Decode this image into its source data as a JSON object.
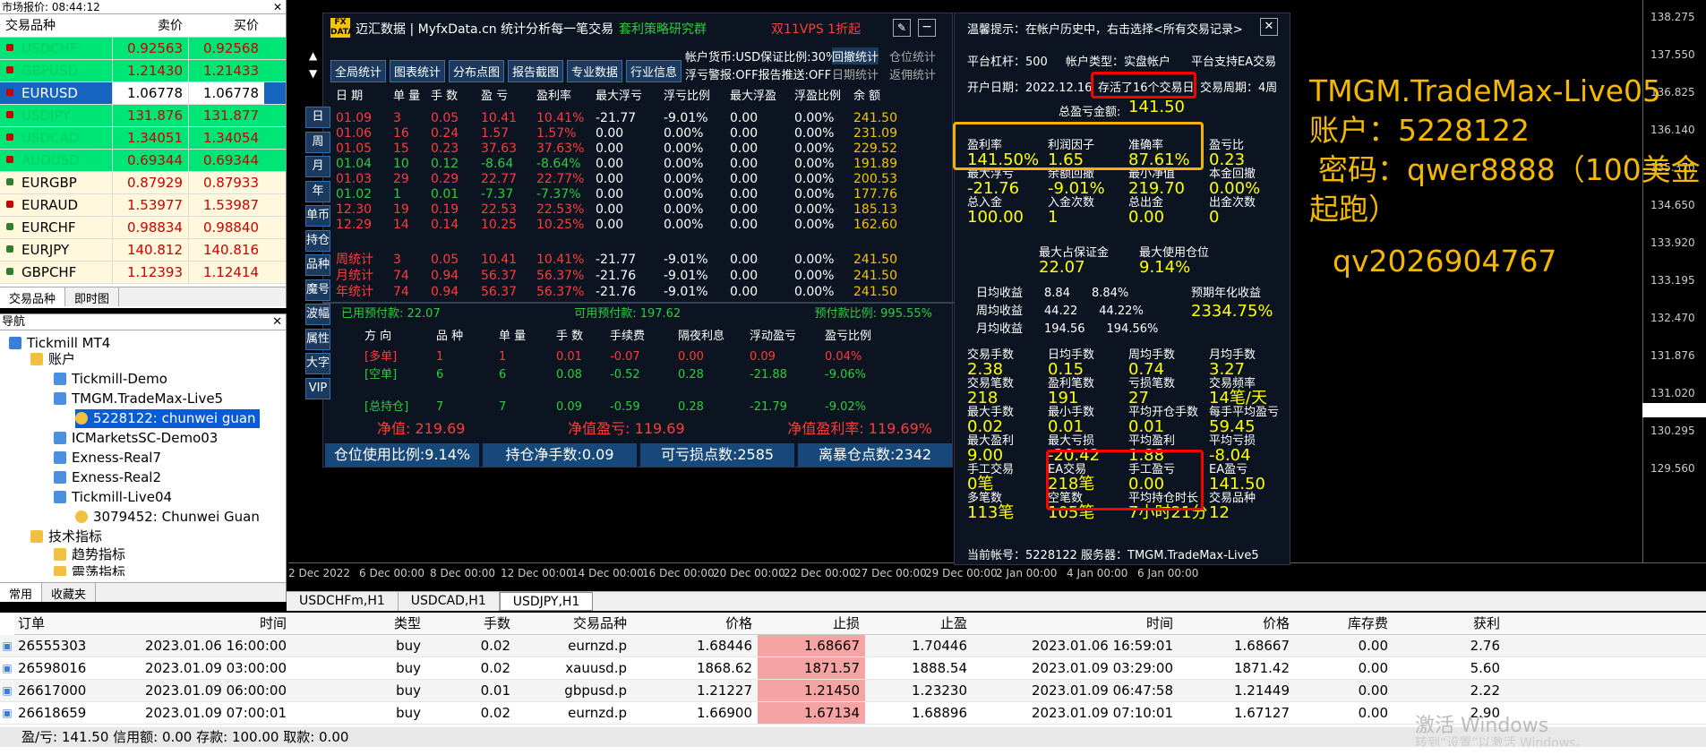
{
  "market_watch": {
    "title": "市场报价: 08:44:12",
    "headers": [
      "交易品种",
      "卖价",
      "买价"
    ],
    "rows": [
      {
        "sym": "USDCHF",
        "bid": "0.92563",
        "ask": "0.92568",
        "bg": "#00e676",
        "ic": "#c00"
      },
      {
        "sym": "GBPUSD",
        "bid": "1.21430",
        "ask": "1.21433",
        "bg": "#00e676",
        "ic": "#c00"
      },
      {
        "sym": "EURUSD",
        "bid": "1.06778",
        "ask": "1.06778",
        "bg": "#1565c0",
        "ic": "#c00"
      },
      {
        "sym": "USDJPY",
        "bid": "131.876",
        "ask": "131.877",
        "bg": "#00e676",
        "ic": "#c00"
      },
      {
        "sym": "USDCAD",
        "bid": "1.34051",
        "ask": "1.34054",
        "bg": "#00e676",
        "ic": "#c00"
      },
      {
        "sym": "AUDUSD",
        "bid": "0.69344",
        "ask": "0.69344",
        "bg": "#00e676",
        "ic": "#c00"
      },
      {
        "sym": "EURGBP",
        "bid": "0.87929",
        "ask": "0.87933",
        "bg": "#fff8dc",
        "ic": "#2e7d32"
      },
      {
        "sym": "EURAUD",
        "bid": "1.53977",
        "ask": "1.53987",
        "bg": "#fff8dc",
        "ic": "#c00"
      },
      {
        "sym": "EURCHF",
        "bid": "0.98834",
        "ask": "0.98840",
        "bg": "#fff8dc",
        "ic": "#2e7d32"
      },
      {
        "sym": "EURJPY",
        "bid": "140.812",
        "ask": "140.816",
        "bg": "#fff8dc",
        "ic": "#2e7d32"
      },
      {
        "sym": "GBPCHF",
        "bid": "1.12393",
        "ask": "1.12414",
        "bg": "#fff8dc",
        "ic": "#2e7d32"
      }
    ],
    "tabs": [
      "交易品种",
      "即时图"
    ]
  },
  "navigator": {
    "title": "导航",
    "items": [
      "Tickmill MT4",
      "账户",
      "Tickmill-Demo",
      "TMGM.TradeMax-Live5",
      "5228122: chunwei guan",
      "ICMarketsSC-Demo03",
      "Exness-Real7",
      "Exness-Real2",
      "Tickmill-Live04",
      "3079452: Chunwei Guan",
      "技术指标",
      "趋势指标",
      "震荡指标"
    ],
    "tabs": [
      "常用",
      "收藏夹"
    ]
  },
  "chart": {
    "yticks": [
      "138.275",
      "137.550",
      "136.825",
      "136.140",
      "135.370",
      "134.650",
      "133.920",
      "133.195",
      "132.470",
      "131.876",
      "131.020",
      "130.295",
      "129.560"
    ],
    "xticks": [
      "2 Dec 2022",
      "6 Dec 00:00",
      "8 Dec 00:00",
      "12 Dec 00:00",
      "14 Dec 00:00",
      "16 Dec 00:00",
      "20 Dec 00:00",
      "22 Dec 00:00",
      "27 Dec 00:00",
      "29 Dec 00:00",
      "2 Jan 00:00",
      "4 Jan 00:00",
      "6 Jan 00:00"
    ],
    "overlay": [
      "TMGM.TradeMax-Live05",
      "账户：5228122",
      "密码：qwer8888（100美金",
      "起跑）",
      "qv2026904767"
    ]
  },
  "stats": {
    "logo": "FX DATA",
    "title": "迈汇数据 | MyfxData.cn  统计分析每一笔交易",
    "promo1": "套利策略研究群",
    "promo2": "双11VPS 1折起",
    "buttons": [
      "全局统计",
      "图表统计",
      "分布点图",
      "报告截图",
      "专业数据",
      "行业信息"
    ],
    "info1": "帐户货币:USD保证比例:30%",
    "info2": "浮亏警报:OFF报告推送:OFF",
    "btn_r": [
      "回撤统计",
      "仓位统计",
      "日期统计",
      "返佣统计"
    ],
    "side_tabs": [
      "日",
      "周",
      "月",
      "年",
      "单币",
      "持仓",
      "品种",
      "魔号",
      "波幅",
      "属性",
      "大字",
      "VIP"
    ],
    "cols": [
      "日 期",
      "单 量",
      "手 数",
      "盈 亏",
      "盈利率",
      "最大浮亏",
      "浮亏比例",
      "最大浮盈",
      "浮盈比例",
      "余 额"
    ],
    "rows": [
      [
        "01.09",
        "3",
        "0.05",
        "10.41",
        "10.41%",
        "-21.77",
        "-9.01%",
        "0.00",
        "0.00%",
        "241.50"
      ],
      [
        "01.06",
        "16",
        "0.24",
        "1.57",
        "1.57%",
        "0.00",
        "0.00%",
        "0.00",
        "0.00%",
        "231.09"
      ],
      [
        "01.05",
        "15",
        "0.23",
        "37.63",
        "37.63%",
        "0.00",
        "0.00%",
        "0.00",
        "0.00%",
        "229.52"
      ],
      [
        "01.04",
        "10",
        "0.12",
        "-8.64",
        "-8.64%",
        "0.00",
        "0.00%",
        "0.00",
        "0.00%",
        "191.89"
      ],
      [
        "01.03",
        "29",
        "0.29",
        "22.77",
        "22.77%",
        "0.00",
        "0.00%",
        "0.00",
        "0.00%",
        "200.53"
      ],
      [
        "01.02",
        "1",
        "0.01",
        "-7.37",
        "-7.37%",
        "0.00",
        "0.00%",
        "0.00",
        "0.00%",
        "177.76"
      ],
      [
        "12.30",
        "19",
        "0.19",
        "22.53",
        "22.53%",
        "0.00",
        "0.00%",
        "0.00",
        "0.00%",
        "185.13"
      ],
      [
        "12.29",
        "14",
        "0.14",
        "10.25",
        "10.25%",
        "0.00",
        "0.00%",
        "0.00",
        "0.00%",
        "162.60"
      ]
    ],
    "sum": [
      [
        "周统计",
        "3",
        "0.05",
        "10.41",
        "10.41%",
        "-21.77",
        "-9.01%",
        "0.00",
        "0.00%",
        "241.50"
      ],
      [
        "月统计",
        "74",
        "0.94",
        "56.37",
        "56.37%",
        "-21.76",
        "-9.01%",
        "0.00",
        "0.00%",
        "241.50"
      ],
      [
        "年统计",
        "74",
        "0.94",
        "56.37",
        "56.37%",
        "-21.76",
        "-9.01%",
        "0.00",
        "0.00%",
        "241.50"
      ]
    ],
    "margin_line": [
      "已用预付款: 22.07",
      "可用预付款: 197.62",
      "预付款比例: 995.55%"
    ],
    "pos_cols": [
      "方 向",
      "品 种",
      "单 量",
      "手 数",
      "手续费",
      "隔夜利息",
      "浮动盈亏",
      "盈亏比例"
    ],
    "pos_rows": [
      [
        "[多单]",
        "1",
        "1",
        "0.01",
        "-0.07",
        "0.00",
        "0.09",
        "0.04%"
      ],
      [
        "[空单]",
        "6",
        "6",
        "0.08",
        "-0.52",
        "0.28",
        "-21.88",
        "-9.06%"
      ],
      [
        "[总持仓]",
        "7",
        "7",
        "0.09",
        "-0.59",
        "0.28",
        "-21.79",
        "-9.02%"
      ]
    ],
    "net": [
      "净值: 219.69",
      "净值盈亏: 119.69",
      "净值盈利率: 119.69%"
    ],
    "bottom": [
      "仓位使用比例:9.14%",
      "持仓净手数:0.09",
      "可亏损点数:2585",
      "离暴仓点数:2342"
    ]
  },
  "right_stats": {
    "tip": "温馨提示：在帐户历史中，右击选择<所有交易记录>",
    "lev": "平台杠杆：500",
    "acct": "帐户类型：实盘帐户",
    "ea": "平台支持EA交易",
    "open": "开户日期：2022.12.16",
    "active": "存活了16个交易日",
    "cycle": "交易周期：4周",
    "total_label": "总盈亏金额:",
    "total": "141.50",
    "cells": [
      [
        "盈利率",
        "141.50%"
      ],
      [
        "利润因子",
        "1.65"
      ],
      [
        "准确率",
        "87.61%"
      ],
      [
        "盈亏比",
        "0.23"
      ],
      [
        "最大浮亏",
        "-21.76"
      ],
      [
        "余额回撤",
        "-9.01%"
      ],
      [
        "最小净值",
        "219.70"
      ],
      [
        "本金回撤",
        "0.00%"
      ],
      [
        "总入金",
        "100.00"
      ],
      [
        "入金次数",
        "1"
      ],
      [
        "总出金",
        "0.00"
      ],
      [
        "出金次数",
        "0"
      ]
    ],
    "margin": [
      [
        "最大占保证金",
        "22.07"
      ],
      [
        "最大使用仓位",
        "9.14%"
      ]
    ],
    "profit": [
      [
        "日均收益",
        "8.84",
        "8.84%"
      ],
      [
        "周均收益",
        "44.22",
        "44.22%"
      ],
      [
        "月均收益",
        "194.56",
        "194.56%"
      ]
    ],
    "yearly_label": "预期年化收益",
    "yearly": "2334.75%",
    "cells2": [
      [
        "交易手数",
        "2.38"
      ],
      [
        "日均手数",
        "0.15"
      ],
      [
        "周均手数",
        "0.74"
      ],
      [
        "月均手数",
        "3.27"
      ],
      [
        "交易笔数",
        "218"
      ],
      [
        "盈利笔数",
        "191"
      ],
      [
        "亏损笔数",
        "27"
      ],
      [
        "交易频率",
        "14笔/天"
      ],
      [
        "最大手数",
        "0.02"
      ],
      [
        "最小手数",
        "0.01"
      ],
      [
        "平均开仓手数",
        "0.01"
      ],
      [
        "每手平均盈亏",
        "59.45"
      ],
      [
        "最大盈利",
        "9.00"
      ],
      [
        "最大亏损",
        "-20.42"
      ],
      [
        "平均盈利",
        "1.88"
      ],
      [
        "平均亏损",
        "-8.04"
      ],
      [
        "手工交易",
        "0笔"
      ],
      [
        "EA交易",
        "218笔"
      ],
      [
        "手工盈亏",
        "0.00"
      ],
      [
        "EA盈亏",
        "141.50"
      ],
      [
        "多笔数",
        "113笔"
      ],
      [
        "空笔数",
        "105笔"
      ],
      [
        "平均持仓时长",
        "7小时21分"
      ],
      [
        "交易品种",
        "12"
      ]
    ],
    "footer": "当前帐号：5228122 服务器：TMGM.TradeMax-Live5"
  },
  "chart_tabs": [
    "USDCHFm,H1",
    "USDCAD,H1",
    "USDJPY,H1"
  ],
  "table": {
    "cols": [
      "订单",
      "时间",
      "类型",
      "手数",
      "交易品种",
      "价格",
      "止损",
      "止盈",
      "时间",
      "价格",
      "库存费",
      "获利"
    ],
    "rows": [
      [
        "26555303",
        "2023.01.06 16:00:00",
        "buy",
        "0.02",
        "eurnzd.p",
        "1.68446",
        "1.68667",
        "1.70446",
        "2023.01.06 16:59:01",
        "1.68667",
        "0.00",
        "2.76"
      ],
      [
        "26598016",
        "2023.01.09 03:00:00",
        "buy",
        "0.02",
        "xauusd.p",
        "1868.62",
        "1871.57",
        "1888.54",
        "2023.01.09 03:29:00",
        "1871.42",
        "0.00",
        "5.60"
      ],
      [
        "26617000",
        "2023.01.09 06:00:00",
        "buy",
        "0.01",
        "gbpusd.p",
        "1.21227",
        "1.21450",
        "1.23230",
        "2023.01.09 06:47:58",
        "1.21449",
        "0.00",
        "2.22"
      ],
      [
        "26618659",
        "2023.01.09 07:00:01",
        "buy",
        "0.02",
        "eurnzd.p",
        "1.66900",
        "1.67134",
        "1.68896",
        "2023.01.09 07:10:01",
        "1.67127",
        "0.00",
        "2.90"
      ]
    ],
    "summary": "盈/亏: 141.50  信用额: 0.00  存款: 100.00  取款: 0.00",
    "watermark": "激活 Windows",
    "watermark2": "转到“设置”以激活 Windows。"
  }
}
